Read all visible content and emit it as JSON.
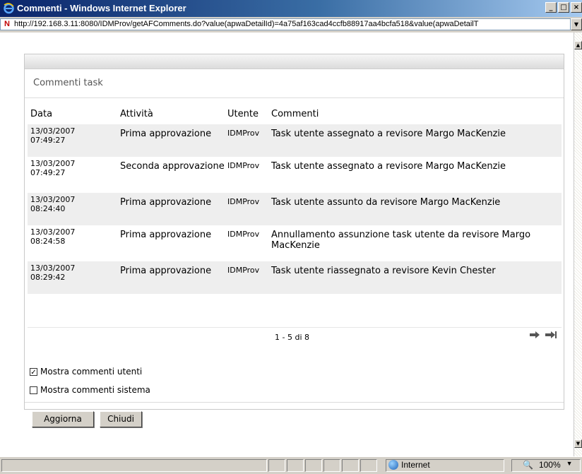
{
  "window": {
    "title": "Commenti - Windows Internet Explorer",
    "url": "http://192.168.3.11:8080/IDMProv/getAFComments.do?value(apwaDetailId)=4a75af163cad4ccfb88917aa4bcfa518&value(apwaDetailT",
    "buttons": [
      "_",
      "□",
      "×"
    ]
  },
  "panel": {
    "title": "Commenti task",
    "columns": [
      "Data",
      "Attività",
      "Utente",
      "Commenti"
    ],
    "rows": [
      {
        "date": "13/03/2007",
        "time": "07:49:27",
        "activity": "Prima approvazione",
        "user": "IDMProv",
        "comment": "Task utente assegnato a revisore Margo MacKenzie"
      },
      {
        "date": "13/03/2007",
        "time": "07:49:27",
        "activity": "Seconda approvazione",
        "user": "IDMProv",
        "comment": "Task utente assegnato a revisore Margo MacKenzie"
      },
      {
        "date": "13/03/2007",
        "time": "08:24:40",
        "activity": "Prima approvazione",
        "user": "IDMProv",
        "comment": "Task utente assunto da revisore Margo MacKenzie"
      },
      {
        "date": "13/03/2007",
        "time": "08:24:58",
        "activity": "Prima approvazione",
        "user": "IDMProv",
        "comment": "Annullamento assunzione task utente da revisore Margo MacKenzie"
      },
      {
        "date": "13/03/2007",
        "time": "08:29:42",
        "activity": "Prima approvazione",
        "user": "IDMProv",
        "comment": "Task utente riassegnato a revisore Kevin Chester"
      }
    ],
    "pagination": {
      "info": "1 - 5 di 8",
      "next_icon": "arrow-right-icon",
      "last_icon": "arrow-last-icon"
    },
    "options": {
      "show_user_comments": {
        "label": "Mostra commenti utenti",
        "checked": true
      },
      "show_system_comments": {
        "label": "Mostra commenti sistema",
        "checked": false
      }
    },
    "buttons": {
      "refresh": "Aggiorna",
      "close": "Chiudi"
    }
  },
  "status": {
    "zone": "Internet",
    "zoom": "100%"
  }
}
